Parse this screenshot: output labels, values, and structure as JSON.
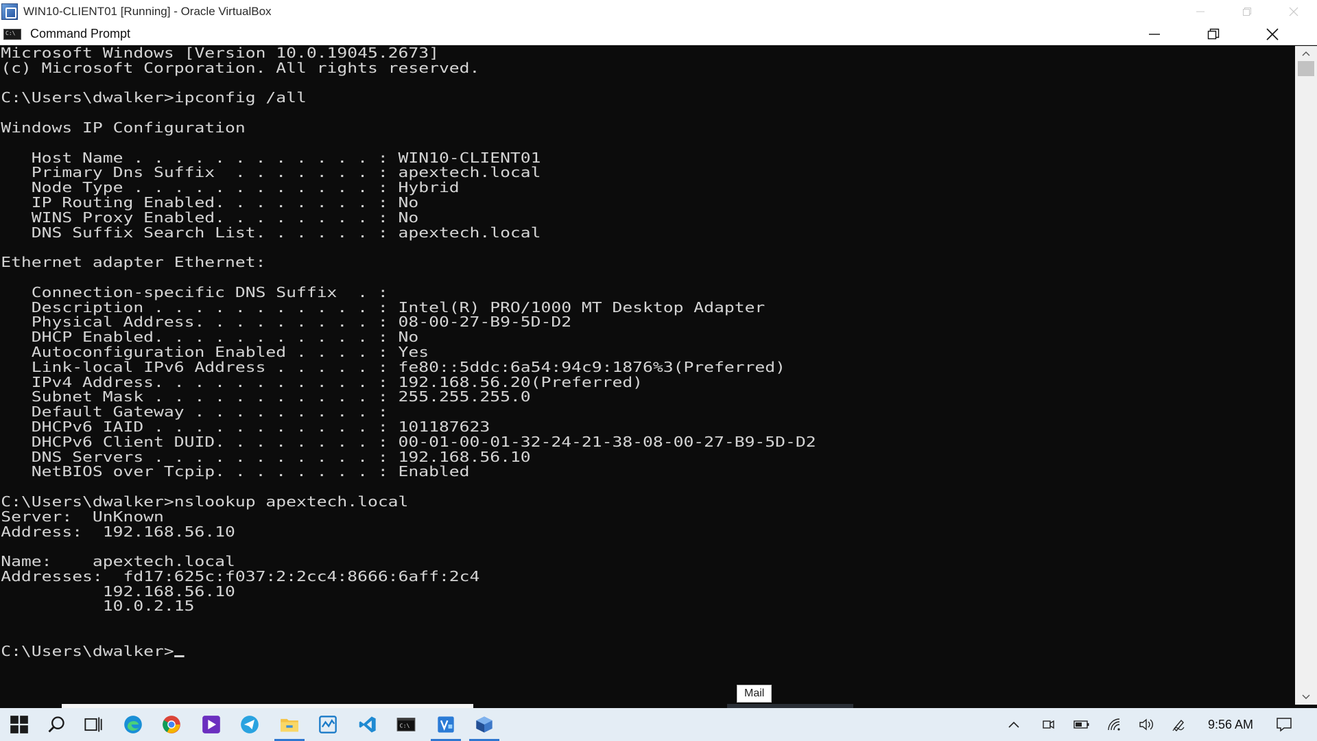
{
  "vbox_window": {
    "title": "WIN10-CLIENT01 [Running] - Oracle VirtualBox",
    "icons": {
      "minimize": "minimize-icon",
      "restore": "restore-icon",
      "close": "close-icon"
    }
  },
  "cmd_window": {
    "title": "Command Prompt"
  },
  "console": {
    "lines": [
      "Microsoft Windows [Version 10.0.19045.2673]",
      "(c) Microsoft Corporation. All rights reserved.",
      "",
      "C:\\Users\\dwalker>ipconfig /all",
      "",
      "Windows IP Configuration",
      "",
      "   Host Name . . . . . . . . . . . . : WIN10-CLIENT01",
      "   Primary Dns Suffix  . . . . . . . : apextech.local",
      "   Node Type . . . . . . . . . . . . : Hybrid",
      "   IP Routing Enabled. . . . . . . . : No",
      "   WINS Proxy Enabled. . . . . . . . : No",
      "   DNS Suffix Search List. . . . . . : apextech.local",
      "",
      "Ethernet adapter Ethernet:",
      "",
      "   Connection-specific DNS Suffix  . :",
      "   Description . . . . . . . . . . . : Intel(R) PRO/1000 MT Desktop Adapter",
      "   Physical Address. . . . . . . . . : 08-00-27-B9-5D-D2",
      "   DHCP Enabled. . . . . . . . . . . : No",
      "   Autoconfiguration Enabled . . . . : Yes",
      "   Link-local IPv6 Address . . . . . : fe80::5ddc:6a54:94c9:1876%3(Preferred)",
      "   IPv4 Address. . . . . . . . . . . : 192.168.56.20(Preferred)",
      "   Subnet Mask . . . . . . . . . . . : 255.255.255.0",
      "   Default Gateway . . . . . . . . . :",
      "   DHCPv6 IAID . . . . . . . . . . . : 101187623",
      "   DHCPv6 Client DUID. . . . . . . . : 00-01-00-01-32-24-21-38-08-00-27-B9-5D-D2",
      "   DNS Servers . . . . . . . . . . . : 192.168.56.10",
      "   NetBIOS over Tcpip. . . . . . . . : Enabled",
      "",
      "C:\\Users\\dwalker>nslookup apextech.local",
      "Server:  UnKnown",
      "Address:  192.168.56.10",
      "",
      "Name:    apextech.local",
      "Addresses:  fd17:625c:f037:2:2cc4:8666:6aff:2c4",
      "          192.168.56.10",
      "          10.0.2.15",
      "",
      ""
    ],
    "prompt": "C:\\Users\\dwalker>"
  },
  "tooltip": {
    "text": "Mail"
  },
  "taskbar": {
    "icons": [
      "windows-start-icon",
      "search-icon",
      "task-view-icon",
      "edge-icon",
      "chrome-icon",
      "media-icon",
      "telegram-icon",
      "file-explorer-icon",
      "task-manager-icon",
      "vscode-icon",
      "cmd-icon",
      "visio-icon",
      "virtualbox-icon"
    ],
    "clock": "9:56 AM"
  },
  "colors": {
    "console_bg": "#0c0c0c",
    "console_fg": "#d4d4d4",
    "taskbar_bg": "#e4edf5",
    "active_indicator": "#2f77d0"
  }
}
